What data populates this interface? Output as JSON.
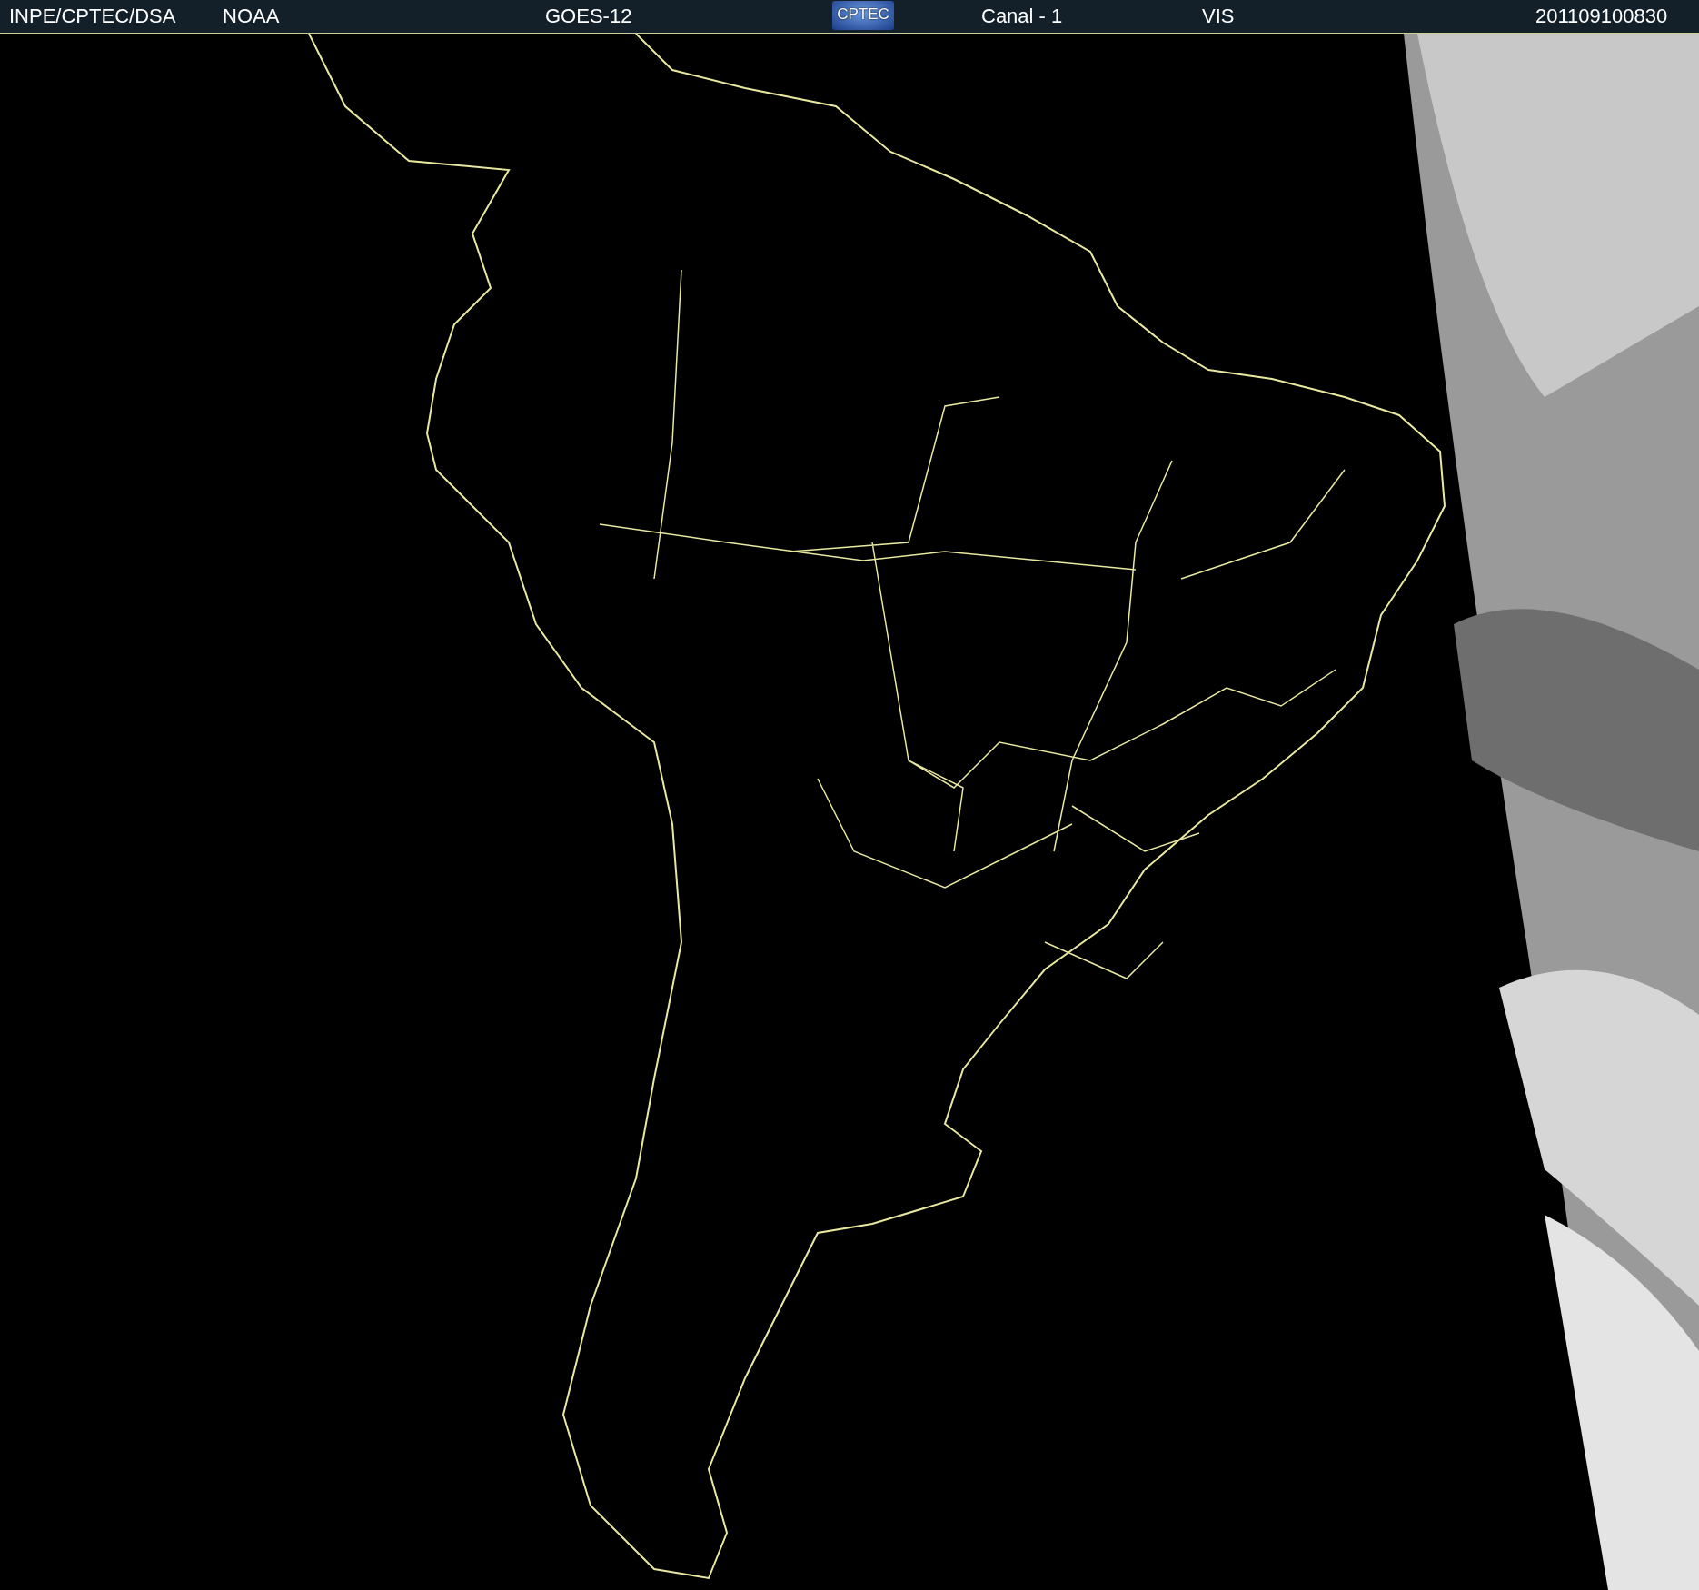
{
  "header": {
    "source": "INPE/CPTEC/DSA",
    "agency": "NOAA",
    "satellite": "GOES-12",
    "logo": "CPTEC",
    "channel": "Canal - 1",
    "band": "VIS",
    "timestamp": "201109100830"
  }
}
